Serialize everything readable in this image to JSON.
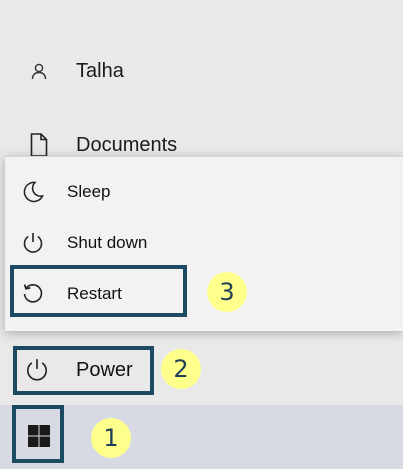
{
  "start_menu": {
    "user": {
      "name": "Talha",
      "icon": "person-icon"
    },
    "documents": {
      "label": "Documents",
      "icon": "document-icon"
    },
    "power_options": [
      {
        "label": "Sleep",
        "icon": "moon-icon"
      },
      {
        "label": "Shut down",
        "icon": "power-icon"
      },
      {
        "label": "Restart",
        "icon": "restart-icon"
      }
    ],
    "power": {
      "label": "Power",
      "icon": "power-icon"
    }
  },
  "taskbar": {
    "start_icon": "windows-logo-icon"
  },
  "annotations": {
    "steps": [
      "1",
      "2",
      "3"
    ],
    "highlight_color": "#1d4a63",
    "badge_color": "#ffff8c"
  }
}
